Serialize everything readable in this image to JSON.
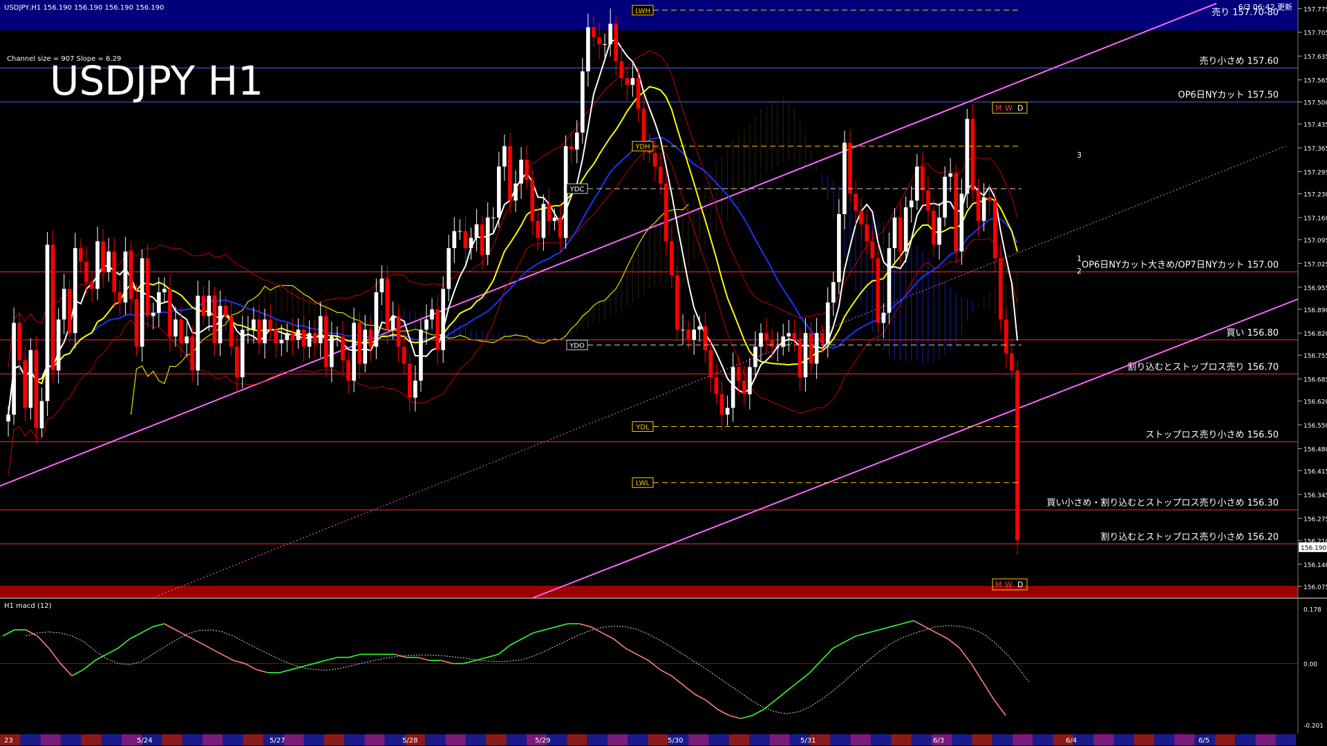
{
  "header": {
    "symbol_line": "USDJPY,H1  156.190 156.190 156.190 156.190",
    "channel_info": "Channel size = 907 Slope = 6.29",
    "big_title": "USDJPY H1",
    "updated": "6/3 06:42 更新"
  },
  "subwindow": {
    "label": "H1  macd (12)"
  },
  "colors": {
    "background": "#000000",
    "sell_zone": "#00007a",
    "buy_zone": "#9a0000",
    "cloud": "#1e2fd8",
    "bull_candle": "#ffffff",
    "bear_candle": "#ff0000",
    "ma_short": "#ffffff",
    "ma_mid": "#ffff00",
    "ma_long": "#1a35ff",
    "bollinger": "#c80000",
    "channel": "#ff66ff",
    "macd_up": "#33ff33",
    "macd_down": "#ff7f7f"
  },
  "chart_data": {
    "type": "candlestick",
    "timeframe": "H1",
    "ylim": [
      156.04,
      157.8
    ],
    "y_ticks": [
      "157.775",
      "157.705",
      "157.635",
      "157.565",
      "157.500",
      "157.435",
      "157.365",
      "157.295",
      "157.230",
      "157.160",
      "157.095",
      "157.025",
      "156.955",
      "156.890",
      "156.820",
      "156.755",
      "156.685",
      "156.620",
      "156.550",
      "156.480",
      "156.415",
      "156.345",
      "156.275",
      "156.210",
      "156.140",
      "156.075"
    ],
    "last_price": "156.190",
    "date_labels": [
      {
        "label": "23",
        "x": 0.0
      },
      {
        "label": "5/24",
        "x": 0.1
      },
      {
        "label": "5/27",
        "x": 0.2
      },
      {
        "label": "5/28",
        "x": 0.3
      },
      {
        "label": "5/29",
        "x": 0.4
      },
      {
        "label": "5/30",
        "x": 0.5
      },
      {
        "label": "5/31",
        "x": 0.6
      },
      {
        "label": "6/3",
        "x": 0.7
      },
      {
        "label": "6/4",
        "x": 0.8
      },
      {
        "label": "6/5",
        "x": 0.9
      }
    ],
    "levels": [
      {
        "label": "売り 157.70-80",
        "price": 157.77,
        "color": "#ffffff"
      },
      {
        "label": "売り小さめ 157.60",
        "price": 157.6,
        "color": "#3b6cff"
      },
      {
        "label": "OP6日NYカット 157.50",
        "price": 157.5,
        "color": "#3b6cff"
      },
      {
        "label": "OP6日NYカット大きめ/OP7日NYカット 157.00",
        "price": 157.0,
        "color": "#ff3030"
      },
      {
        "label": "買い 156.80",
        "price": 156.8,
        "color": "#ff3030"
      },
      {
        "label": "割り込むとストップロス売り 156.70",
        "price": 156.7,
        "color": "#ff3030"
      },
      {
        "label": "ストップロス売り小さめ 156.50",
        "price": 156.5,
        "color": "#ff3030"
      },
      {
        "label": "買い小さめ・割り込むとストップロス売り小さめ 156.30",
        "price": 156.3,
        "color": "#ff3030"
      },
      {
        "label": "割り込むとストップロス売り小さめ 156.20",
        "price": 156.2,
        "color": "#ff3030"
      }
    ],
    "markers": [
      {
        "label": "LWH",
        "x": 0.465,
        "price": 157.77
      },
      {
        "label": "YDH",
        "x": 0.48,
        "price": 157.37
      },
      {
        "label": "YDC",
        "x": 0.43,
        "price": 157.245
      },
      {
        "label": "YDO",
        "x": 0.43,
        "price": 156.785
      },
      {
        "label": "YDL",
        "x": 0.48,
        "price": 156.545
      },
      {
        "label": "LWL",
        "x": 0.465,
        "price": 156.38
      }
    ],
    "channel_labels": [
      "1",
      "2",
      "3"
    ],
    "mwd_box": [
      "M",
      "W",
      "D"
    ],
    "candles": [
      156.58,
      156.85,
      156.74,
      156.6,
      156.77,
      156.54,
      156.62,
      157.08,
      156.71,
      156.86,
      156.95,
      156.82,
      157.07,
      157.03,
      156.97,
      156.95,
      157.09,
      157.0,
      157.06,
      156.94,
      156.91,
      157.06,
      156.92,
      156.78,
      157.04,
      156.87,
      156.88,
      156.94,
      156.95,
      156.81,
      156.86,
      156.79,
      156.81,
      156.71,
      156.93,
      156.87,
      156.93,
      156.79,
      156.9,
      156.87,
      156.78,
      156.69,
      156.83,
      156.83,
      156.86,
      156.79,
      156.86,
      156.83,
      156.79,
      156.8,
      156.82,
      156.8,
      156.83,
      156.78,
      156.82,
      156.79,
      156.87,
      156.72,
      156.81,
      156.81,
      156.74,
      156.68,
      156.85,
      156.73,
      156.83,
      156.78,
      156.94,
      156.98,
      156.83,
      156.87,
      156.78,
      156.73,
      156.63,
      156.68,
      156.83,
      156.86,
      156.89,
      156.77,
      156.95,
      157.07,
      157.12,
      157.12,
      157.07,
      157.1,
      157.14,
      157.05,
      157.16,
      157.16,
      157.31,
      157.37,
      157.21,
      157.26,
      157.33,
      157.27,
      157.15,
      157.1,
      157.2,
      157.15,
      157.16,
      157.1,
      157.37,
      157.36,
      157.41,
      157.59,
      157.72,
      157.69,
      157.67,
      157.67,
      157.73,
      157.62,
      157.57,
      157.55,
      157.57,
      157.48,
      157.37,
      157.35,
      157.31,
      157.26,
      157.09,
      156.99,
      156.83,
      156.83,
      156.8,
      156.83,
      156.84,
      156.77,
      156.69,
      156.64,
      156.58,
      156.6,
      156.72,
      156.68,
      156.64,
      156.72,
      156.78,
      156.82,
      156.8,
      156.78,
      156.78,
      156.81,
      156.82,
      156.8,
      156.69,
      156.82,
      156.73,
      156.82,
      156.79,
      156.91,
      156.97,
      157.17,
      157.38,
      157.23,
      157.18,
      157.14,
      157.09,
      157.04,
      156.85,
      156.88,
      157.07,
      157.16,
      157.06,
      157.19,
      157.21,
      157.31,
      157.24,
      157.18,
      157.08,
      157.16,
      157.28,
      157.29,
      157.06,
      157.23,
      157.45,
      157.24,
      157.15,
      157.22,
      157.21,
      157.04,
      156.86,
      156.76,
      156.71,
      156.21
    ],
    "macd": [
      0.09,
      0.11,
      0.11,
      0.09,
      0.05,
      0.0,
      -0.04,
      -0.02,
      0.01,
      0.03,
      0.05,
      0.08,
      0.1,
      0.12,
      0.13,
      0.11,
      0.09,
      0.07,
      0.05,
      0.03,
      0.01,
      0.0,
      -0.02,
      -0.03,
      -0.03,
      -0.02,
      -0.01,
      -0.0,
      0.01,
      0.02,
      0.02,
      0.03,
      0.03,
      0.03,
      0.03,
      0.02,
      0.02,
      0.01,
      0.01,
      0.0,
      0.0,
      0.01,
      0.02,
      0.03,
      0.06,
      0.08,
      0.1,
      0.11,
      0.12,
      0.13,
      0.13,
      0.12,
      0.1,
      0.08,
      0.05,
      0.03,
      0.01,
      -0.02,
      -0.04,
      -0.07,
      -0.1,
      -0.12,
      -0.15,
      -0.17,
      -0.18,
      -0.17,
      -0.15,
      -0.12,
      -0.09,
      -0.06,
      -0.03,
      0.01,
      0.05,
      0.07,
      0.09,
      0.1,
      0.11,
      0.12,
      0.13,
      0.14,
      0.12,
      0.1,
      0.08,
      0.05,
      0.0,
      -0.06,
      -0.12,
      -0.17
    ],
    "macd_ylim": [
      -0.22,
      0.2
    ],
    "macd_ticks": [
      "0.178",
      "0.00",
      "-0.201"
    ]
  }
}
